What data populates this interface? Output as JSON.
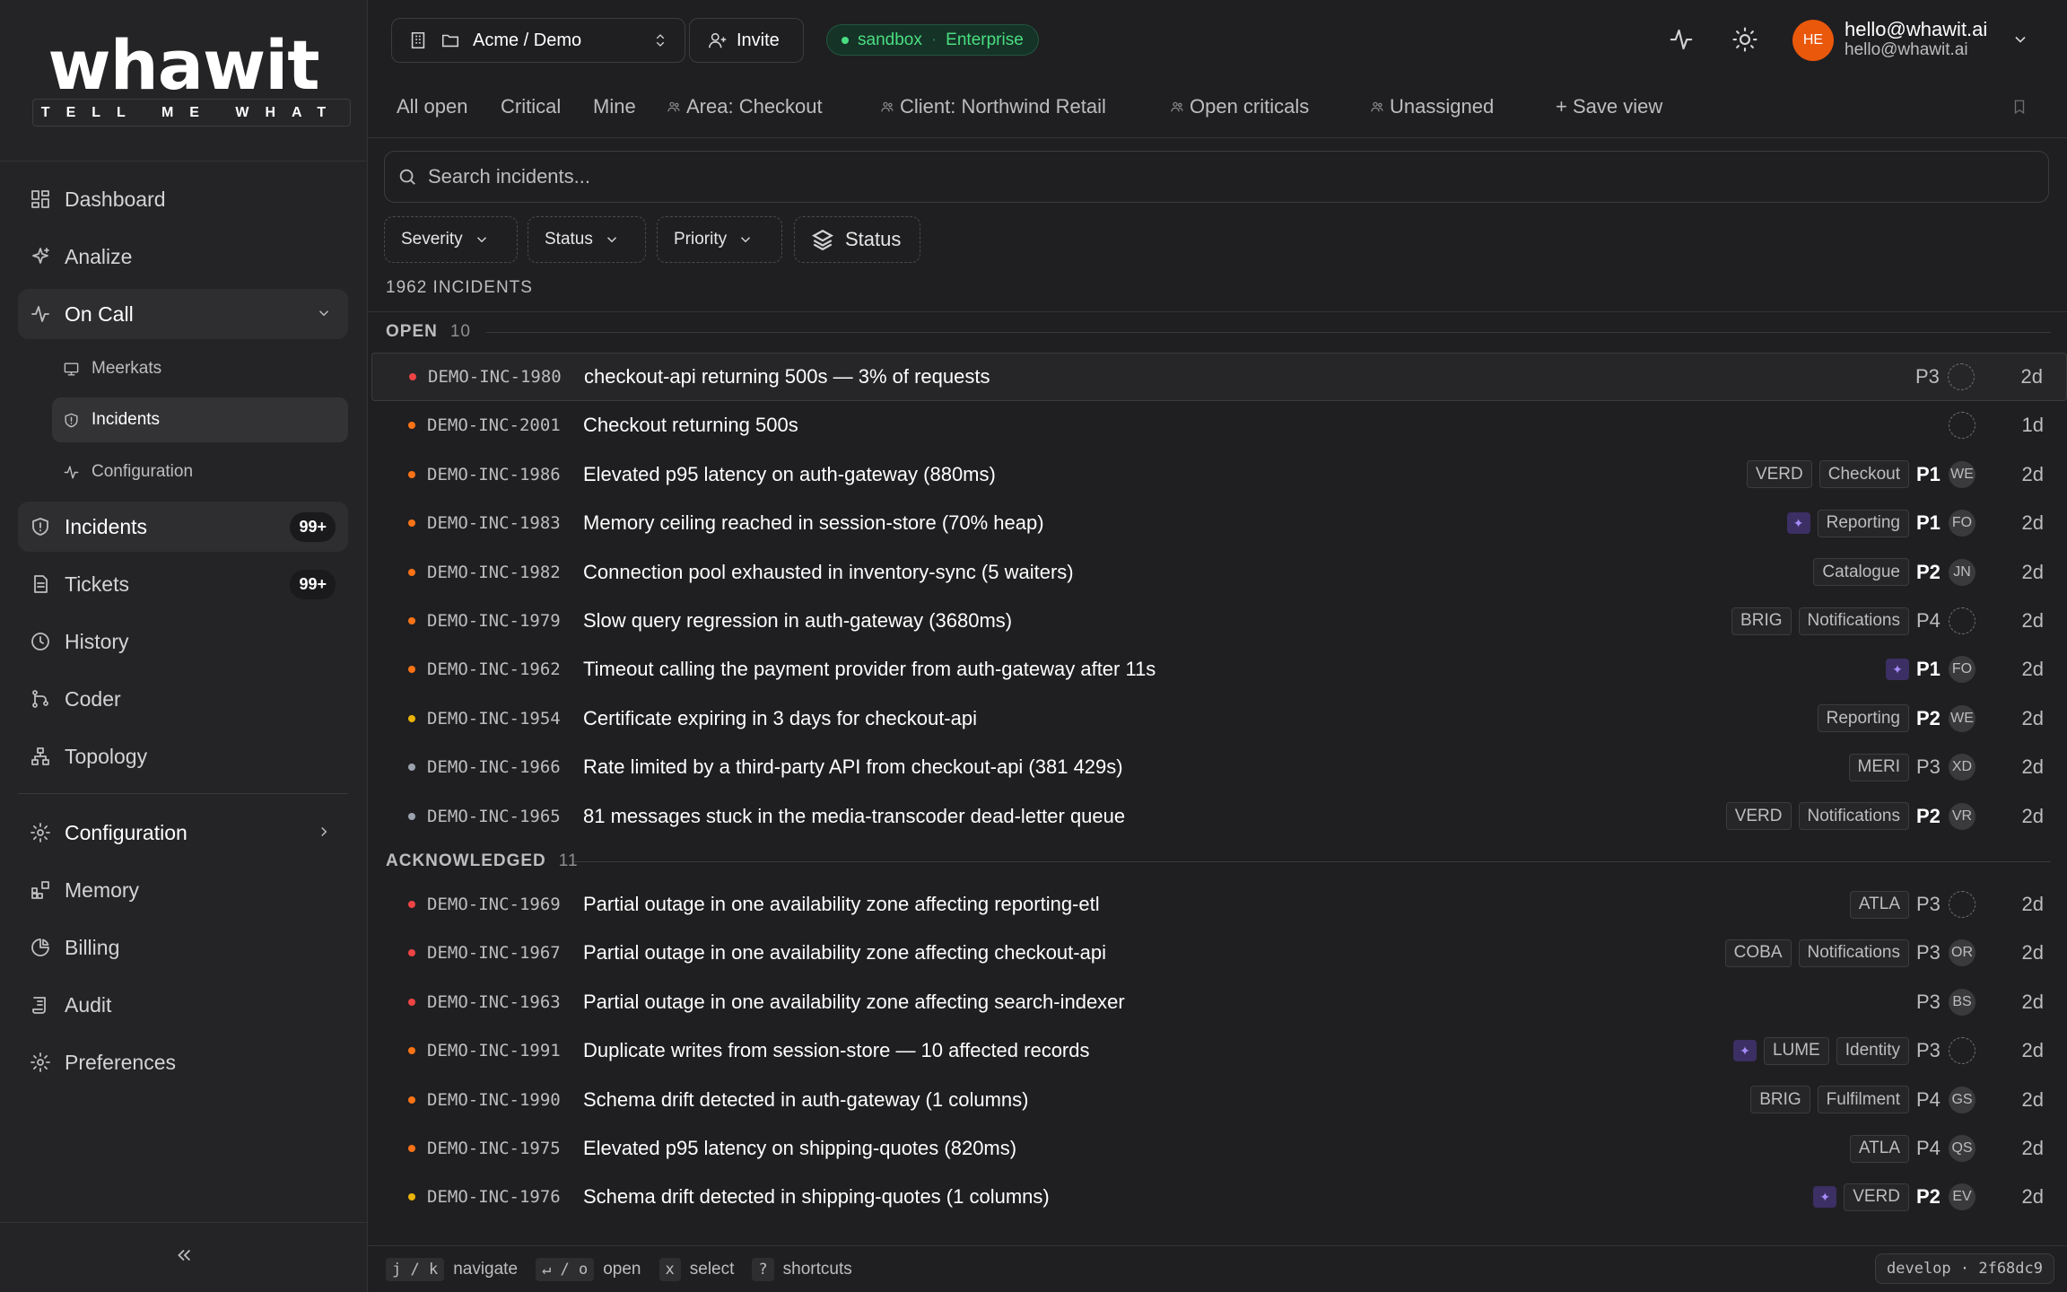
{
  "brand": {
    "logo": "whawit",
    "tagline": "TELL ME WHAT"
  },
  "sidebar": {
    "items": [
      {
        "label": "Dashboard",
        "icon": "dashboard-icon"
      },
      {
        "label": "Analize",
        "icon": "sparkles-icon"
      },
      {
        "label": "On Call",
        "icon": "pulse-icon"
      },
      {
        "label": "Meerkats",
        "icon": "monitor-icon"
      },
      {
        "label": "Incidents",
        "icon": "shield-icon"
      },
      {
        "label": "Configuration",
        "icon": "pulse-icon"
      },
      {
        "label": "Incidents",
        "icon": "shield-icon",
        "badge": "99+"
      },
      {
        "label": "Tickets",
        "icon": "file-icon",
        "badge": "99+"
      },
      {
        "label": "History",
        "icon": "clock-icon"
      },
      {
        "label": "Coder",
        "icon": "git-icon"
      },
      {
        "label": "Topology",
        "icon": "network-icon"
      },
      {
        "label": "Configuration",
        "icon": "gear-icon"
      },
      {
        "label": "Memory",
        "icon": "blocks-icon"
      },
      {
        "label": "Billing",
        "icon": "pie-icon"
      },
      {
        "label": "Audit",
        "icon": "scroll-icon"
      },
      {
        "label": "Preferences",
        "icon": "gear-icon"
      }
    ]
  },
  "topbar": {
    "org": "Acme / Demo",
    "invite": "Invite",
    "env": "sandbox",
    "plan": "Enterprise",
    "user_initials": "HE",
    "user_name": "hello@whawit.ai",
    "user_email": "hello@whawit.ai"
  },
  "views": [
    "All open",
    "Critical",
    "Mine",
    "Area: Checkout",
    "Client: Northwind Retail",
    "Open criticals",
    "Unassigned",
    "+ Save view"
  ],
  "search": {
    "placeholder": "Search incidents..."
  },
  "filters": [
    "Severity",
    "Status",
    "Priority",
    "Status"
  ],
  "count_label": "1962 INCIDENTS",
  "groups": {
    "open": {
      "label": "OPEN",
      "count": "10"
    },
    "ack": {
      "label": "ACKNOWLEDGED",
      "count": "11"
    }
  },
  "rows": [
    {
      "id": "DEMO-INC-1980",
      "title": "checkout-api returning 500s — 3% of requests",
      "sev": "#ef4444",
      "tags": [],
      "prio": "P3",
      "assignee": "",
      "age": "2d"
    },
    {
      "id": "DEMO-INC-2001",
      "title": "Checkout returning 500s",
      "sev": "#f97316",
      "tags": [],
      "prio": "",
      "assignee": "",
      "age": "1d"
    },
    {
      "id": "DEMO-INC-1986",
      "title": "Elevated p95 latency on auth-gateway (880ms)",
      "sev": "#f97316",
      "tags": [
        "VERD",
        "Checkout"
      ],
      "prio": "P1",
      "assignee": "WE",
      "age": "2d"
    },
    {
      "id": "DEMO-INC-1983",
      "title": "Memory ceiling reached in session-store (70% heap)",
      "sev": "#f97316",
      "tags": [
        "Reporting"
      ],
      "ai": true,
      "prio": "P1",
      "assignee": "FO",
      "age": "2d"
    },
    {
      "id": "DEMO-INC-1982",
      "title": "Connection pool exhausted in inventory-sync (5 waiters)",
      "sev": "#f97316",
      "tags": [
        "Catalogue"
      ],
      "prio": "P2",
      "assignee": "JN",
      "age": "2d"
    },
    {
      "id": "DEMO-INC-1979",
      "title": "Slow query regression in auth-gateway (3680ms)",
      "sev": "#f97316",
      "tags": [
        "BRIG",
        "Notifications"
      ],
      "prio": "P4",
      "assignee": "",
      "age": "2d"
    },
    {
      "id": "DEMO-INC-1962",
      "title": "Timeout calling the payment provider from auth-gateway after 11s",
      "sev": "#f97316",
      "tags": [],
      "ai": true,
      "prio": "P1",
      "assignee": "FO",
      "age": "2d"
    },
    {
      "id": "DEMO-INC-1954",
      "title": "Certificate expiring in 3 days for checkout-api",
      "sev": "#eab308",
      "tags": [
        "Reporting"
      ],
      "prio": "P2",
      "assignee": "WE",
      "age": "2d"
    },
    {
      "id": "DEMO-INC-1966",
      "title": "Rate limited by a third-party API from checkout-api (381 429s)",
      "sev": "#9ca3af",
      "tags": [
        "MERI"
      ],
      "prio": "P3",
      "assignee": "XD",
      "age": "2d"
    },
    {
      "id": "DEMO-INC-1965",
      "title": "81 messages stuck in the media-transcoder dead-letter queue",
      "sev": "#9ca3af",
      "tags": [
        "VERD",
        "Notifications"
      ],
      "prio": "P2",
      "assignee": "VR",
      "age": "2d"
    },
    {
      "id": "DEMO-INC-1969",
      "title": "Partial outage in one availability zone affecting reporting-etl",
      "sev": "#ef4444",
      "tags": [
        "ATLA"
      ],
      "prio": "P3",
      "assignee": "",
      "age": "2d"
    },
    {
      "id": "DEMO-INC-1967",
      "title": "Partial outage in one availability zone affecting checkout-api",
      "sev": "#ef4444",
      "tags": [
        "COBA",
        "Notifications"
      ],
      "prio": "P3",
      "assignee": "OR",
      "age": "2d"
    },
    {
      "id": "DEMO-INC-1963",
      "title": "Partial outage in one availability zone affecting search-indexer",
      "sev": "#ef4444",
      "tags": [],
      "prio": "P3",
      "assignee": "BS",
      "age": "2d"
    },
    {
      "id": "DEMO-INC-1991",
      "title": "Duplicate writes from session-store — 10 affected records",
      "sev": "#f97316",
      "tags": [
        "LUME",
        "Identity"
      ],
      "ai": true,
      "prio": "P3",
      "assignee": "",
      "age": "2d"
    },
    {
      "id": "DEMO-INC-1990",
      "title": "Schema drift detected in auth-gateway (1 columns)",
      "sev": "#f97316",
      "tags": [
        "BRIG",
        "Fulfilment"
      ],
      "prio": "P4",
      "assignee": "GS",
      "age": "2d"
    },
    {
      "id": "DEMO-INC-1975",
      "title": "Elevated p95 latency on shipping-quotes (820ms)",
      "sev": "#f97316",
      "tags": [
        "ATLA"
      ],
      "prio": "P4",
      "assignee": "QS",
      "age": "2d"
    },
    {
      "id": "DEMO-INC-1976",
      "title": "Schema drift detected in shipping-quotes (1 columns)",
      "sev": "#eab308",
      "tags": [
        "VERD"
      ],
      "ai": true,
      "prio": "P2",
      "assignee": "EV",
      "age": "2d"
    }
  ],
  "footer": {
    "navigate_keys": "j / k",
    "navigate": "navigate",
    "open_keys": "↵ / o",
    "open": "open",
    "select_key": "x",
    "select": "select",
    "shortcuts_key": "?",
    "shortcuts": "shortcuts",
    "version": "develop · 2f68dc9"
  }
}
